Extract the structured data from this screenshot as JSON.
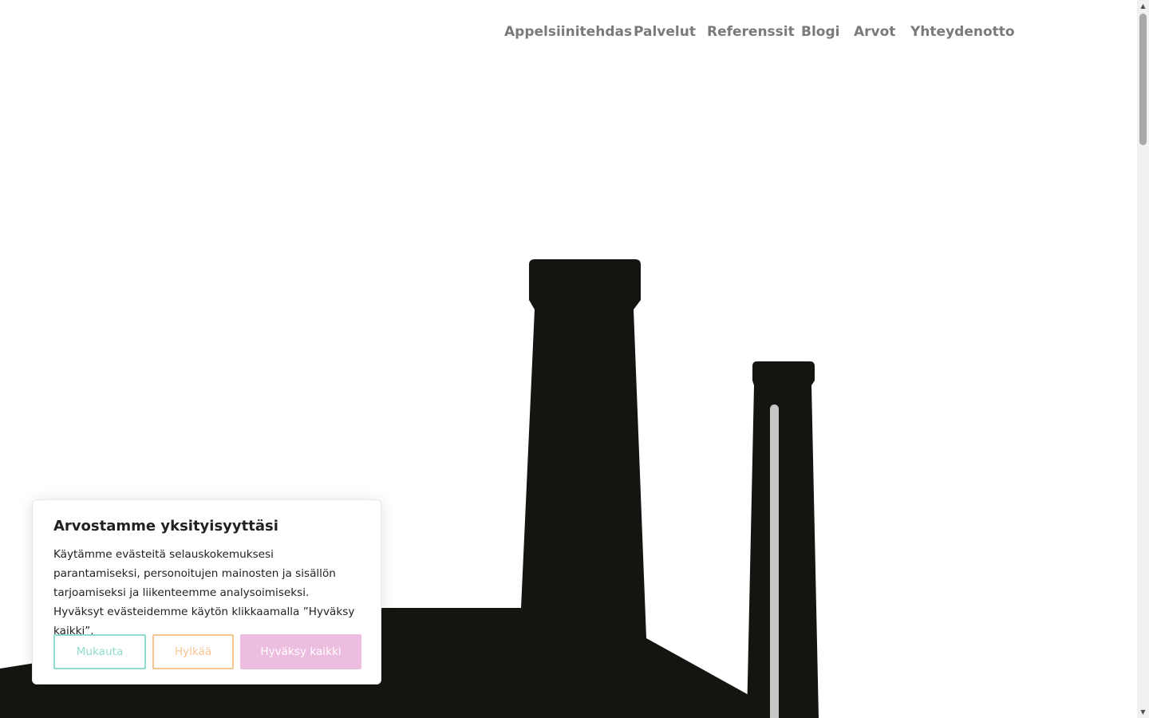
{
  "nav": {
    "items": [
      {
        "label": "Appelsiinitehdas"
      },
      {
        "label": "Palvelut"
      },
      {
        "label": "Referenssit"
      },
      {
        "label": "Blogi"
      },
      {
        "label": "Arvot"
      },
      {
        "label": "Yhteydenotto"
      }
    ]
  },
  "cookie": {
    "title": "Arvostamme yksityisyyttäsi",
    "text": "Käytämme evästeitä selauskokemuksesi parantamiseksi, personoitujen mainosten ja sisällön tarjoamiseksi ja liikenteemme analysoimiseksi. Hyväksyt evästeidemme käytön klikkaamalla ”Hyväksy kaikki”.",
    "customize_label": "Mukauta",
    "reject_label": "Hylkää",
    "accept_label": "Hyväksy kaikki"
  },
  "scrollbar": {
    "up_icon": "▲",
    "down_icon": "▼"
  },
  "colors": {
    "nav_text": "#7a7a7a",
    "silhouette": "#141410",
    "customize_accent": "#8fdccd",
    "reject_accent": "#f5c592",
    "accept_accent": "#edbde0"
  }
}
